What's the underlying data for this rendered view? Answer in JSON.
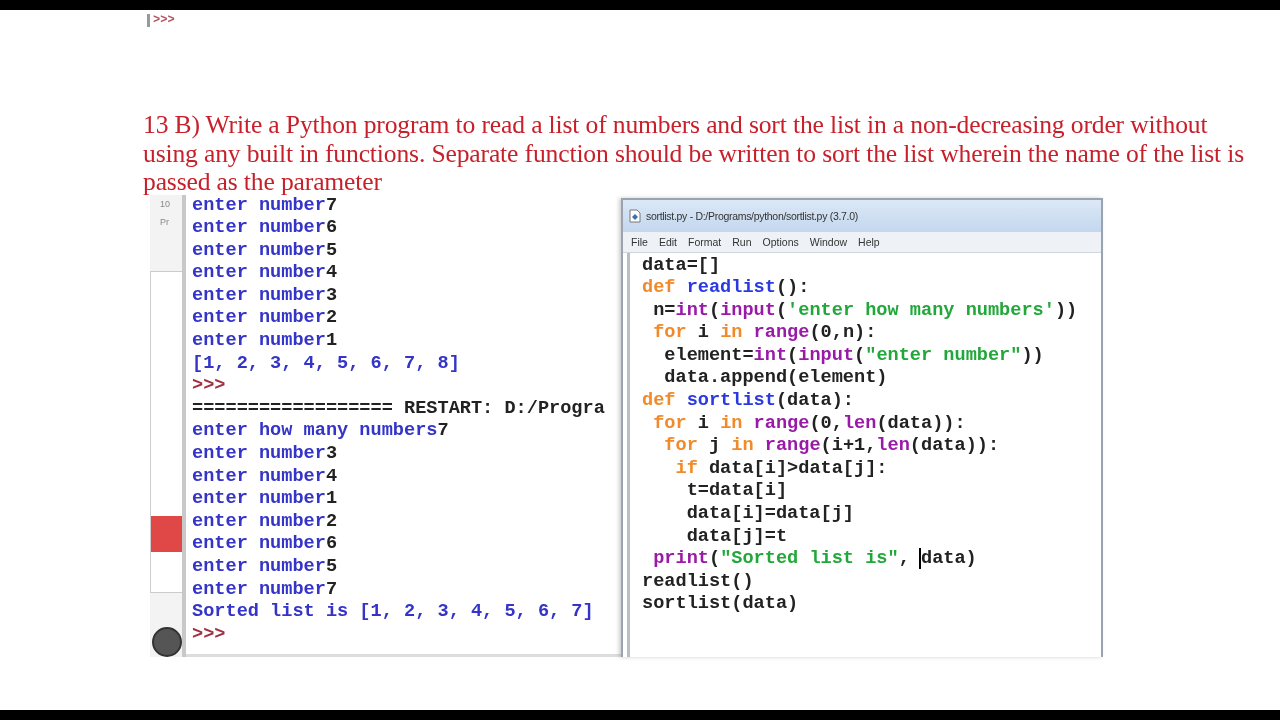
{
  "top_prompt": ">>>",
  "question": "13 B) Write a Python program to read a list of numbers and sort the list in a non-decreasing order without using any built in functions. Separate function should be written to sort the list wherein the name of the list is passed as the parameter",
  "behind_window": {
    "texts": [
      "10",
      "Pr"
    ]
  },
  "shell": {
    "lines": [
      {
        "tokens": [
          {
            "kind": "stdout",
            "text": "enter number"
          },
          {
            "kind": "stdin",
            "text": "7"
          }
        ]
      },
      {
        "tokens": [
          {
            "kind": "stdout",
            "text": "enter number"
          },
          {
            "kind": "stdin",
            "text": "6"
          }
        ]
      },
      {
        "tokens": [
          {
            "kind": "stdout",
            "text": "enter number"
          },
          {
            "kind": "stdin",
            "text": "5"
          }
        ]
      },
      {
        "tokens": [
          {
            "kind": "stdout",
            "text": "enter number"
          },
          {
            "kind": "stdin",
            "text": "4"
          }
        ]
      },
      {
        "tokens": [
          {
            "kind": "stdout",
            "text": "enter number"
          },
          {
            "kind": "stdin",
            "text": "3"
          }
        ]
      },
      {
        "tokens": [
          {
            "kind": "stdout",
            "text": "enter number"
          },
          {
            "kind": "stdin",
            "text": "2"
          }
        ]
      },
      {
        "tokens": [
          {
            "kind": "stdout",
            "text": "enter number"
          },
          {
            "kind": "stdin",
            "text": "1"
          }
        ]
      },
      {
        "tokens": [
          {
            "kind": "stdout",
            "text": "[1, 2, 3, 4, 5, 6, 7, 8]"
          }
        ]
      },
      {
        "tokens": [
          {
            "kind": "prompt",
            "text": ">>>"
          }
        ]
      },
      {
        "tokens": [
          {
            "kind": "stdin",
            "text": "================== RESTART: D:/Progra"
          }
        ]
      },
      {
        "tokens": [
          {
            "kind": "stdout",
            "text": "enter how many numbers"
          },
          {
            "kind": "stdin",
            "text": "7"
          }
        ]
      },
      {
        "tokens": [
          {
            "kind": "stdout",
            "text": "enter number"
          },
          {
            "kind": "stdin",
            "text": "3"
          }
        ]
      },
      {
        "tokens": [
          {
            "kind": "stdout",
            "text": "enter number"
          },
          {
            "kind": "stdin",
            "text": "4"
          }
        ]
      },
      {
        "tokens": [
          {
            "kind": "stdout",
            "text": "enter number"
          },
          {
            "kind": "stdin",
            "text": "1"
          }
        ]
      },
      {
        "tokens": [
          {
            "kind": "stdout",
            "text": "enter number"
          },
          {
            "kind": "stdin",
            "text": "2"
          }
        ]
      },
      {
        "tokens": [
          {
            "kind": "stdout",
            "text": "enter number"
          },
          {
            "kind": "stdin",
            "text": "6"
          }
        ]
      },
      {
        "tokens": [
          {
            "kind": "stdout",
            "text": "enter number"
          },
          {
            "kind": "stdin",
            "text": "5"
          }
        ]
      },
      {
        "tokens": [
          {
            "kind": "stdout",
            "text": "enter number"
          },
          {
            "kind": "stdin",
            "text": "7"
          }
        ]
      },
      {
        "tokens": [
          {
            "kind": "stdout",
            "text": "Sorted list is [1, 2, 3, 4, 5, 6, 7]"
          }
        ]
      },
      {
        "tokens": [
          {
            "kind": "prompt",
            "text": ">>>"
          }
        ]
      }
    ]
  },
  "editor": {
    "title": "sortlist.py - D:/Programs/python/sortlist.py (3.7.0)",
    "menu": [
      "File",
      "Edit",
      "Format",
      "Run",
      "Options",
      "Window",
      "Help"
    ],
    "lines": [
      {
        "tokens": [
          {
            "kind": "plain",
            "text": "data=[]"
          }
        ]
      },
      {
        "tokens": [
          {
            "kind": "keyword",
            "text": "def"
          },
          {
            "kind": "definition",
            "text": " readlist"
          },
          {
            "kind": "plain",
            "text": "():"
          }
        ]
      },
      {
        "tokens": [
          {
            "kind": "plain",
            "text": " n="
          },
          {
            "kind": "builtin",
            "text": "int"
          },
          {
            "kind": "plain",
            "text": "("
          },
          {
            "kind": "builtin",
            "text": "input"
          },
          {
            "kind": "plain",
            "text": "("
          },
          {
            "kind": "string",
            "text": "'enter how many numbers'"
          },
          {
            "kind": "plain",
            "text": "))"
          }
        ]
      },
      {
        "tokens": [
          {
            "kind": "keyword",
            "text": " for"
          },
          {
            "kind": "plain",
            "text": " i "
          },
          {
            "kind": "keyword",
            "text": "in"
          },
          {
            "kind": "builtin",
            "text": " range"
          },
          {
            "kind": "plain",
            "text": "(0,n):"
          }
        ]
      },
      {
        "tokens": [
          {
            "kind": "plain",
            "text": "  element="
          },
          {
            "kind": "builtin",
            "text": "int"
          },
          {
            "kind": "plain",
            "text": "("
          },
          {
            "kind": "builtin",
            "text": "input"
          },
          {
            "kind": "plain",
            "text": "("
          },
          {
            "kind": "string",
            "text": "\"enter number\""
          },
          {
            "kind": "plain",
            "text": "))"
          }
        ]
      },
      {
        "tokens": [
          {
            "kind": "plain",
            "text": "  data.append(element)"
          }
        ]
      },
      {
        "tokens": [
          {
            "kind": "keyword",
            "text": "def"
          },
          {
            "kind": "definition",
            "text": " sortlist"
          },
          {
            "kind": "plain",
            "text": "(data):"
          }
        ]
      },
      {
        "tokens": [
          {
            "kind": "keyword",
            "text": " for"
          },
          {
            "kind": "plain",
            "text": " i "
          },
          {
            "kind": "keyword",
            "text": "in"
          },
          {
            "kind": "builtin",
            "text": " range"
          },
          {
            "kind": "plain",
            "text": "(0,"
          },
          {
            "kind": "builtin",
            "text": "len"
          },
          {
            "kind": "plain",
            "text": "(data)):"
          }
        ]
      },
      {
        "tokens": [
          {
            "kind": "keyword",
            "text": "  for"
          },
          {
            "kind": "plain",
            "text": " j "
          },
          {
            "kind": "keyword",
            "text": "in"
          },
          {
            "kind": "builtin",
            "text": " range"
          },
          {
            "kind": "plain",
            "text": "(i+1,"
          },
          {
            "kind": "builtin",
            "text": "len"
          },
          {
            "kind": "plain",
            "text": "(data)):"
          }
        ]
      },
      {
        "tokens": [
          {
            "kind": "keyword",
            "text": "   if"
          },
          {
            "kind": "plain",
            "text": " data[i]>data[j]:"
          }
        ]
      },
      {
        "tokens": [
          {
            "kind": "plain",
            "text": "    t=data[i]"
          }
        ]
      },
      {
        "tokens": [
          {
            "kind": "plain",
            "text": "    data[i]=data[j]"
          }
        ]
      },
      {
        "tokens": [
          {
            "kind": "plain",
            "text": "    data[j]=t"
          }
        ]
      },
      {
        "tokens": [
          {
            "kind": "builtin",
            "text": " print"
          },
          {
            "kind": "plain",
            "text": "("
          },
          {
            "kind": "string",
            "text": "\"Sorted list is\""
          },
          {
            "kind": "plain",
            "text": ", "
          },
          {
            "kind": "plain",
            "text": "data)",
            "cursor_before": true
          }
        ]
      },
      {
        "tokens": [
          {
            "kind": "plain",
            "text": "readlist()"
          }
        ]
      },
      {
        "tokens": [
          {
            "kind": "plain",
            "text": "sortlist(data)"
          }
        ]
      }
    ]
  }
}
